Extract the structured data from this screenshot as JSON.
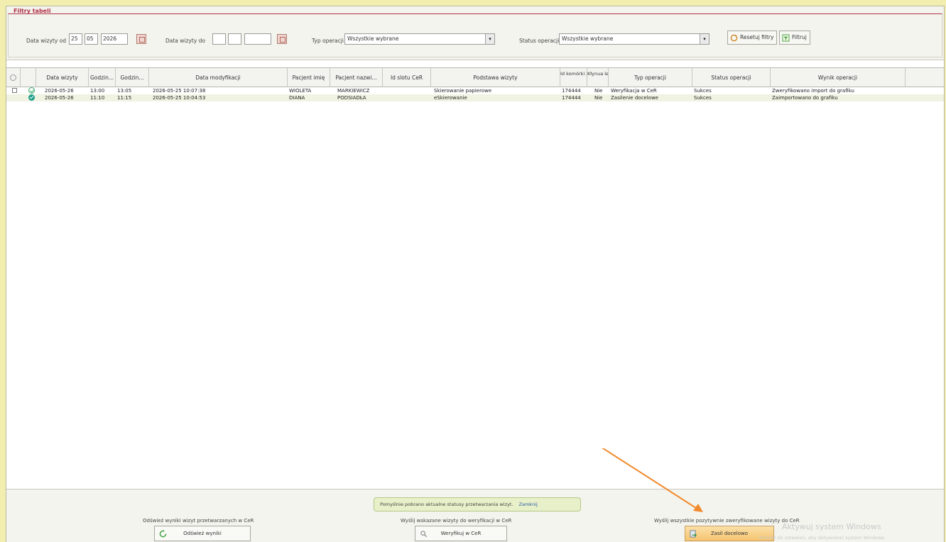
{
  "filters": {
    "title": "Filtry tabeli",
    "date_from_label": "Data wizyty od",
    "date_from_day": "25",
    "date_from_month": "05",
    "date_from_year": "2026",
    "date_to_label": "Data wizyty do",
    "date_to_day": "",
    "date_to_month": "",
    "date_to_year": "",
    "op_type_label": "Typ operacji",
    "op_type_value": "Wszystkie wybrane",
    "op_status_label": "Status operacji",
    "op_status_value": "Wszystkie wybrane",
    "reset_label": "Resetuj filtry",
    "filter_label": "Filtruj"
  },
  "table": {
    "headers": [
      "",
      "",
      "Data wizyty",
      "Godzin...",
      "Godzin...",
      "Data modyfikacji",
      "Pacjent imię",
      "Pacjent nazwi...",
      "Id slotu CeR",
      "Podstawa wizyty",
      "Id komórki ze słow...",
      "Kłynua lecz...",
      "Typ operacji",
      "Status operacji",
      "Wynik operacji"
    ],
    "rows": [
      {
        "status": "outline",
        "date": "2026-05-26",
        "from": "13:00",
        "to": "13:05",
        "modified": "2026-05-25 10:07:38",
        "first_name": "WIOLETA",
        "last_name": "MARKIEWICZ",
        "slot_id": "",
        "basis": "Skierowanie papierowe",
        "cell_id": "174444",
        "flag": "Nie",
        "op_type": "Weryfikacja w CeR",
        "op_status": "Sukces",
        "result": "Zweryfikowano import do grafiku"
      },
      {
        "status": "filled",
        "date": "2026-05-26",
        "from": "11:10",
        "to": "11:15",
        "modified": "2026-05-25 10:04:53",
        "first_name": "DIANA",
        "last_name": "PODSIADŁA",
        "slot_id": "",
        "basis": "eSkierowanie",
        "cell_id": "174444",
        "flag": "Nie",
        "op_type": "Zasilenie docelowe",
        "op_status": "Sukces",
        "result": "Zaimportowano do grafiku"
      }
    ]
  },
  "bottom": {
    "toast_text": "Pomyślnie pobrano aktualne statusy przetwarzania wizyt.",
    "toast_close": "Zamknij",
    "refresh_caption": "Odśwież wyniki wizyt przetwarzanych w CeR",
    "refresh_button": "Odśwież wyniki",
    "verify_caption": "Wyślij wskazane wizyty do weryfikacji w CeR",
    "verify_button": "Weryfikuj w CeR",
    "send_caption": "Wyślij wszystkie pozytywnie zweryfikowane wizyty do CeR",
    "send_button": "Zasil docelowo",
    "watermark_title": "Aktywuj system Windows",
    "watermark_sub": "Przejdź do ustawień, aby aktywować system Windows."
  },
  "colors": {
    "accent_title": "#b0314a",
    "annotation_arrow": "#f08a2c",
    "success_icon": "#1f9e8a"
  }
}
